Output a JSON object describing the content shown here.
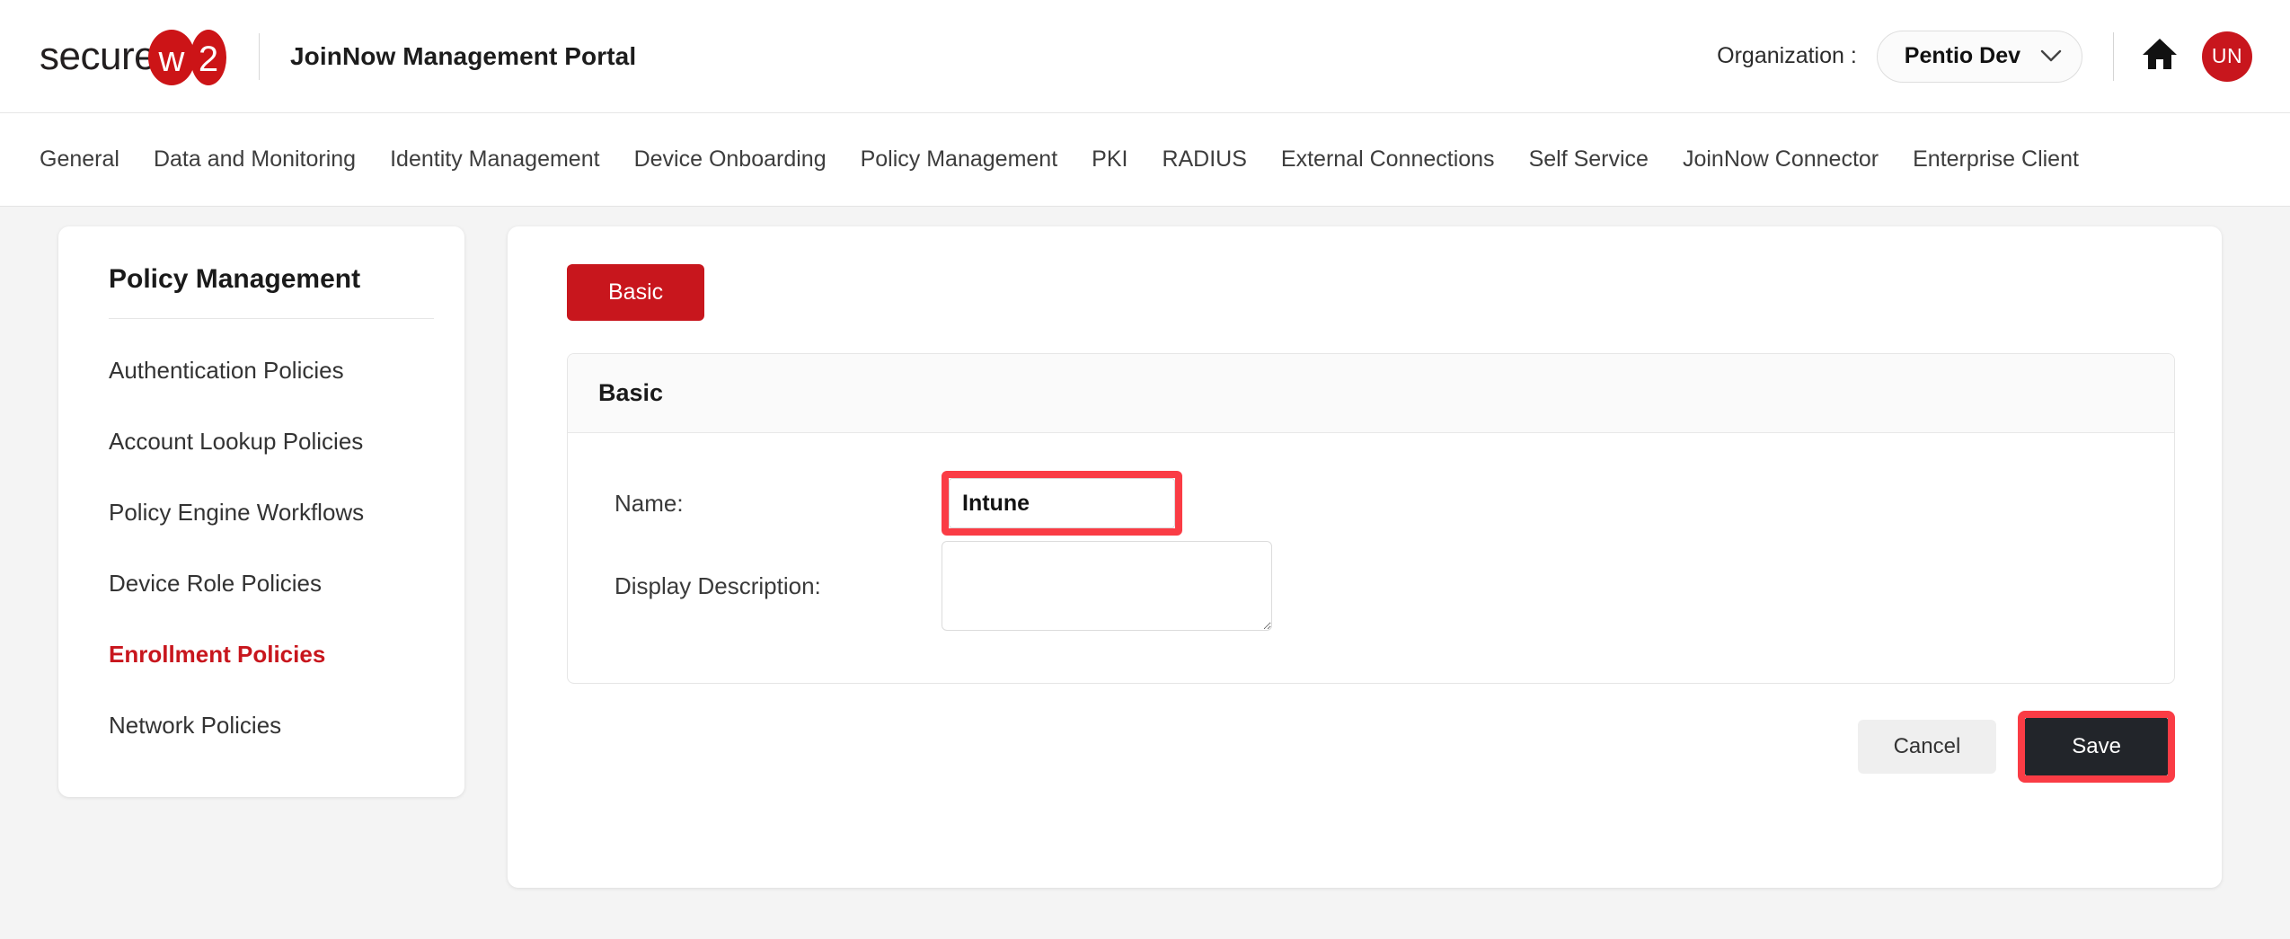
{
  "header": {
    "logo_text_left": "secure",
    "logo_text_w": "w",
    "logo_text_2": "2",
    "portal_title": "JoinNow Management Portal",
    "org_label": "Organization :",
    "org_value": "Pentio Dev",
    "home_icon": "home-icon",
    "chevron_icon": "chevron-down-icon",
    "avatar_initials": "UN",
    "brand_color": "#c8161d"
  },
  "nav": {
    "items": [
      {
        "label": "General"
      },
      {
        "label": "Data and Monitoring"
      },
      {
        "label": "Identity Management"
      },
      {
        "label": "Device Onboarding"
      },
      {
        "label": "Policy Management"
      },
      {
        "label": "PKI"
      },
      {
        "label": "RADIUS"
      },
      {
        "label": "External Connections"
      },
      {
        "label": "Self Service"
      },
      {
        "label": "JoinNow Connector"
      },
      {
        "label": "Enterprise Client"
      }
    ]
  },
  "sidebar": {
    "title": "Policy Management",
    "items": [
      {
        "label": "Authentication Policies",
        "active": false
      },
      {
        "label": "Account Lookup Policies",
        "active": false
      },
      {
        "label": "Policy Engine Workflows",
        "active": false
      },
      {
        "label": "Device Role Policies",
        "active": false
      },
      {
        "label": "Enrollment Policies",
        "active": true
      },
      {
        "label": "Network Policies",
        "active": false
      }
    ],
    "active_color": "#c8161d"
  },
  "main": {
    "tab_label": "Basic",
    "panel_title": "Basic",
    "fields": {
      "name_label": "Name:",
      "name_value": "Intune",
      "name_placeholder": "",
      "description_label": "Display Description:",
      "description_value": "",
      "description_placeholder": ""
    },
    "buttons": {
      "cancel_label": "Cancel",
      "save_label": "Save"
    },
    "annotations": {
      "highlight_color": "#fa3c45",
      "name_field_highlighted": true,
      "save_button_highlighted": true
    }
  }
}
